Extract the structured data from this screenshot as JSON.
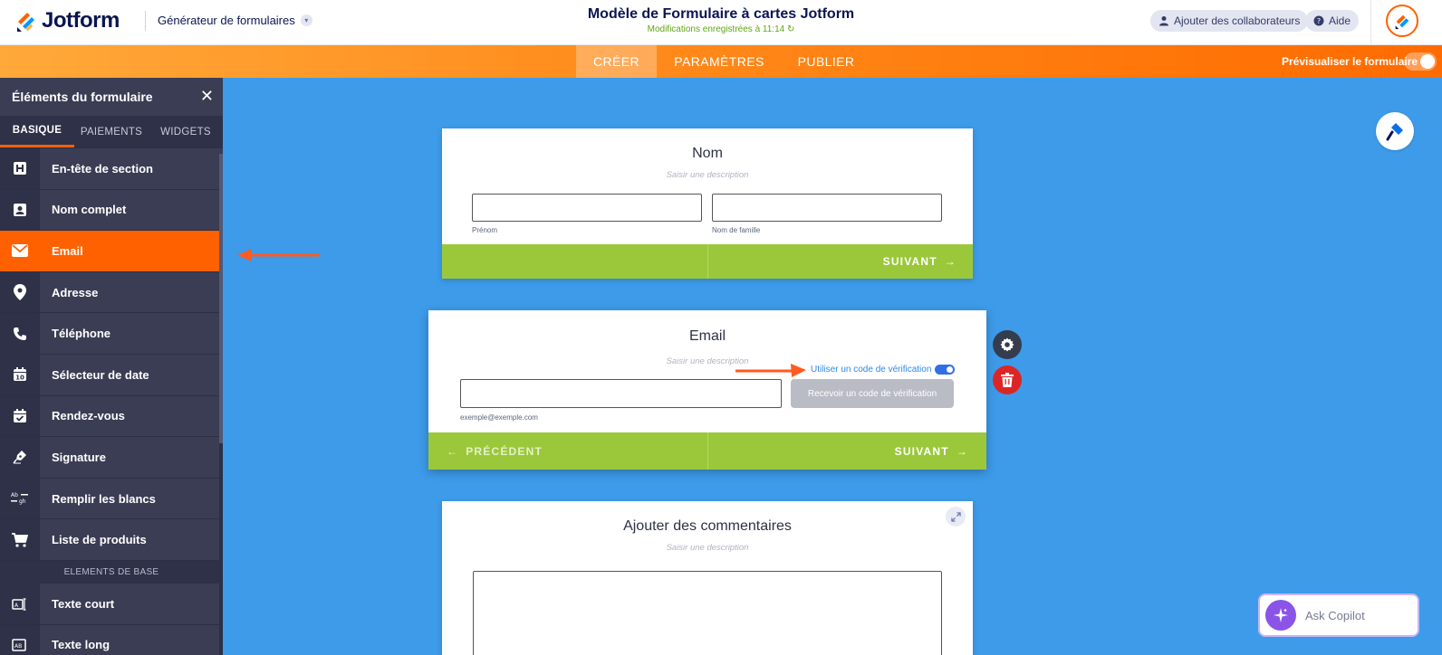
{
  "header": {
    "logo_text": "Jotform",
    "builder_menu": "Générateur de formulaires",
    "form_title": "Modèle de Formulaire à cartes Jotform",
    "save_status": "Modifications enregistrées à 11:14",
    "collaborators_label": "Ajouter des collaborateurs",
    "help_label": "Aide"
  },
  "nav": {
    "tabs": [
      {
        "label": "CRÉER",
        "active": true
      },
      {
        "label": "PARAMÈTRES",
        "active": false
      },
      {
        "label": "PUBLIER",
        "active": false
      }
    ],
    "preview_label": "Prévisualiser le formulaire"
  },
  "sidebar": {
    "title": "Éléments du formulaire",
    "tabs": [
      {
        "label": "BASIQUE",
        "active": true
      },
      {
        "label": "PAIEMENTS",
        "active": false
      },
      {
        "label": "WIDGETS",
        "active": false
      }
    ],
    "items": [
      {
        "label": "En-tête de section",
        "icon": "heading-icon"
      },
      {
        "label": "Nom complet",
        "icon": "contact-card-icon"
      },
      {
        "label": "Email",
        "icon": "envelope-icon",
        "active": true
      },
      {
        "label": "Adresse",
        "icon": "map-pin-icon"
      },
      {
        "label": "Téléphone",
        "icon": "phone-icon"
      },
      {
        "label": "Sélecteur de date",
        "icon": "calendar-icon"
      },
      {
        "label": "Rendez-vous",
        "icon": "calendar-check-icon"
      },
      {
        "label": "Signature",
        "icon": "pen-nib-icon"
      },
      {
        "label": "Remplir les blancs",
        "icon": "fill-blanks-icon"
      },
      {
        "label": "Liste de produits",
        "icon": "cart-icon"
      }
    ],
    "category_label": "ELEMENTS DE BASE",
    "items_after": [
      {
        "label": "Texte court",
        "icon": "short-text-icon"
      },
      {
        "label": "Texte long",
        "icon": "long-text-icon"
      }
    ]
  },
  "cards": {
    "name": {
      "title": "Nom",
      "description": "Saisir une description",
      "first_sublabel": "Prénom",
      "last_sublabel": "Nom de famille",
      "next_label": "SUIVANT"
    },
    "email": {
      "title": "Email",
      "description": "Saisir une description",
      "verification_label": "Utiliser un code de vérification",
      "verify_button": "Recevoir un code de vérification",
      "sublabel": "exemple@exemple.com",
      "prev_label": "PRÉCÉDENT",
      "next_label": "SUIVANT"
    },
    "comments": {
      "title": "Ajouter des commentaires",
      "description": "Saisir une description"
    }
  },
  "copilot": {
    "label": "Ask Copilot"
  },
  "colors": {
    "brand_orange": "#ff6100",
    "canvas_blue": "#3d9be9",
    "footer_green": "#9bc83a",
    "sidebar_dark": "#3a3d53"
  }
}
